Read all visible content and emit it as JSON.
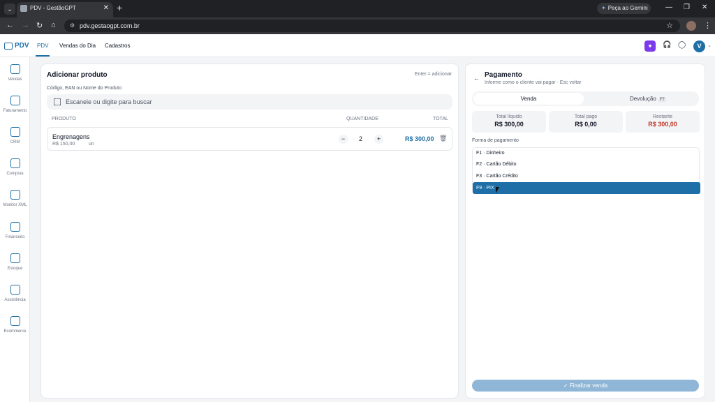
{
  "browser": {
    "tab_title": "PDV - GestãoGPT",
    "gemini_label": "Peça ao Gemini",
    "url": "pdv.gestaogpt.com.br"
  },
  "app": {
    "logo": "PDV",
    "nav": [
      "PDV",
      "Vendas do Dia",
      "Cadastros"
    ],
    "avatar": "V",
    "ai_icon": "sparkle-icon"
  },
  "sidebar": {
    "items": [
      {
        "label": "Vendas",
        "icon": "basket-icon"
      },
      {
        "label": "Faturamento",
        "icon": "document-icon"
      },
      {
        "label": "CRM",
        "icon": "chat-icon"
      },
      {
        "label": "Compras",
        "icon": "cart-icon"
      },
      {
        "label": "Monitor XML",
        "icon": "file-icon"
      },
      {
        "label": "Financeiro",
        "icon": "money-icon"
      },
      {
        "label": "Estoque",
        "icon": "boxes-icon"
      },
      {
        "label": "Assistência",
        "icon": "tools-icon"
      },
      {
        "label": "Ecommerce",
        "icon": "bag-icon"
      }
    ]
  },
  "add_product": {
    "title": "Adicionar produto",
    "hint": "Enter = adicionar",
    "field_label": "Código, EAN ou Nome do Produto",
    "search_placeholder": "Escaneie ou digite para buscar",
    "columns": [
      "PRODUTO",
      "QUANTIDADE",
      "TOTAL"
    ],
    "items": [
      {
        "name": "Engrenagens",
        "unit_price": "R$ 150,00",
        "unit": "un",
        "qty": "2",
        "total": "R$ 300,00"
      }
    ]
  },
  "payment": {
    "title": "Pagamento",
    "subtitle": "Informe como o cliente vai pagar · Esc voltar",
    "tabs": {
      "active": "Venda",
      "other": "Devolução",
      "other_key": "F7"
    },
    "summary": [
      {
        "label": "Total líquido",
        "value": "R$ 300,00"
      },
      {
        "label": "Total pago",
        "value": "R$ 0,00"
      },
      {
        "label": "Restante",
        "value": "R$ 300,00"
      }
    ],
    "method_label": "Forma de pagamento",
    "methods": [
      "F1 · Dinheiro",
      "F2 · Cartão Débito",
      "F3 · Cartão Crédito",
      "F9 · PIX"
    ],
    "selected_method": "F9 · PIX",
    "finalize_label": "Finalizar venda"
  },
  "colors": {
    "accent": "#1e6fa8",
    "danger": "#c0392b",
    "ai": "#7c3aed"
  }
}
